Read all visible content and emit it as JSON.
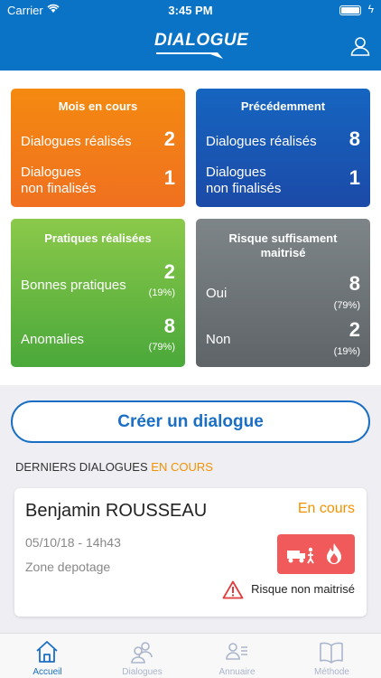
{
  "status_bar": {
    "carrier": "Carrier",
    "time": "3:45 PM"
  },
  "header": {
    "logo": "DIALOGUE"
  },
  "cards": {
    "current": {
      "title": "Mois en cours",
      "done_label": "Dialogues réalisés",
      "done_value": "2",
      "unfinished_label_1": "Dialogues",
      "unfinished_label_2": "non finalisés",
      "unfinished_value": "1"
    },
    "previous": {
      "title": "Précédemment",
      "done_label": "Dialogues réalisés",
      "done_value": "8",
      "unfinished_label_1": "Dialogues",
      "unfinished_label_2": "non finalisés",
      "unfinished_value": "1"
    },
    "practices": {
      "title": "Pratiques réalisées",
      "good_label": "Bonnes pratiques",
      "good_value": "2",
      "good_pct": "(19%)",
      "anomalies_label": "Anomalies",
      "anomalies_value": "8",
      "anomalies_pct": "(79%)"
    },
    "risk": {
      "title_1": "Risque suffisament",
      "title_2": "maitrisé",
      "yes_label": "Oui",
      "yes_value": "8",
      "yes_pct": "(79%)",
      "no_label": "Non",
      "no_value": "2",
      "no_pct": "(19%)"
    }
  },
  "create_button": "Créer un dialogue",
  "section": {
    "title": "DERNIERS DIALOGUES",
    "highlight": "EN COURS"
  },
  "dialogue": {
    "name": "Benjamin ROUSSEAU",
    "status": "En cours",
    "date": "05/10/18 - 14h43",
    "zone": "Zone depotage",
    "risk_label": "Risque non maitrisé"
  },
  "tabs": [
    {
      "label": "Accueil",
      "icon": "home-icon",
      "active": true
    },
    {
      "label": "Dialogues",
      "icon": "users-icon",
      "active": false
    },
    {
      "label": "Annuaire",
      "icon": "contacts-icon",
      "active": false
    },
    {
      "label": "Méthode",
      "icon": "book-icon",
      "active": false
    }
  ],
  "colors": {
    "brand": "#0a73c6",
    "orange": "#f39200",
    "danger": "#f05a5a"
  }
}
